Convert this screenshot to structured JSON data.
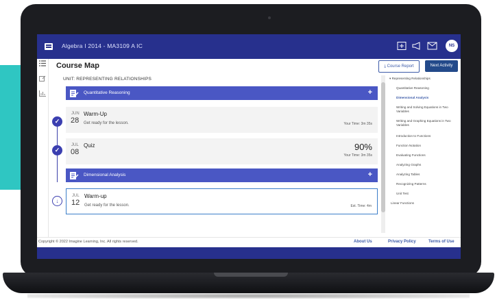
{
  "app": {
    "title": "Algebra I 2014 - MA3109 A IC",
    "avatar_initials": "NS"
  },
  "page": {
    "title": "Course Map",
    "course_report_label": "Course Report",
    "next_activity_label": "Next Activity",
    "unit_label": "UNIT: REPRESENTING RELATIONSHIPS"
  },
  "lessons": [
    {
      "label": "Quantitative Reasoning"
    },
    {
      "label": "Dimensional Analysis"
    }
  ],
  "activities": [
    {
      "month": "JUN",
      "day": "28",
      "title": "Warm-Up",
      "subtitle": "Get ready for the lesson.",
      "right": "Your Time: 3m 35s"
    },
    {
      "month": "JUL",
      "day": "08",
      "title": "Quiz",
      "score": "90%",
      "right": "Your Time: 3m 35s"
    },
    {
      "month": "JUL",
      "day": "12",
      "title": "Warm-up",
      "subtitle": "Get ready for the lesson.",
      "right": "Est. Time: 4m"
    }
  ],
  "tree": {
    "root": "▾ Representing Relationships",
    "items": [
      "Quantitative Reasoning",
      "Dimensional Analysis",
      "Writing and Solving Equations in Two Variables",
      "Writing and Graphing Equations in Two Variables",
      "Introduction to Functions",
      "Function Notation",
      "Evaluating Functions",
      "Analyzing Graphs",
      "Analyzing Tables",
      "Recognizing Patterns",
      "Unit Test"
    ],
    "next_unit": "Linear Functions"
  },
  "footer": {
    "copyright": "Copyright © 2022 Imagine Learning, Inc. All rights reserved.",
    "about": "About Us",
    "privacy": "Privacy Policy",
    "terms": "Terms of Use"
  },
  "colors": {
    "brand_navy": "#27308d",
    "lesson_bar": "#4a57c4",
    "teal_accent": "#2fc6c2",
    "link_blue": "#3b5aa8"
  }
}
